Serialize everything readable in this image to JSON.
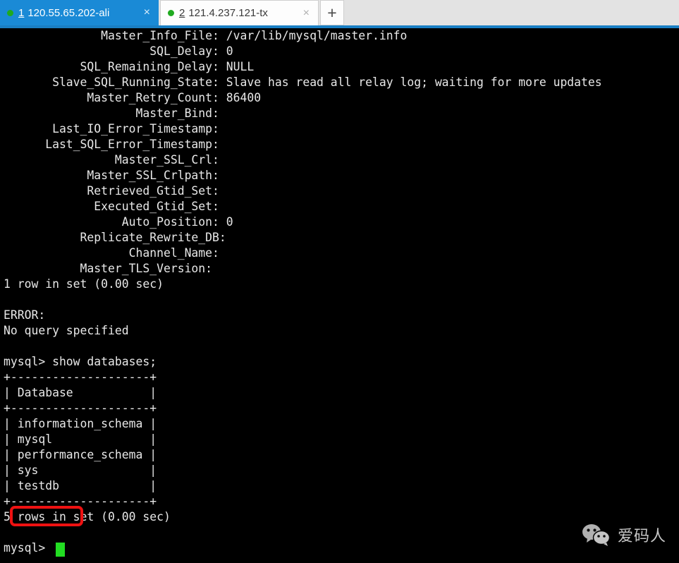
{
  "tabs": [
    {
      "index": "1",
      "title": "120.55.65.202-ali",
      "status_icon": "green-dot-icon",
      "close_icon": "×",
      "active": true
    },
    {
      "index": "2",
      "title": "121.4.237.121-tx",
      "status_icon": "green-dot-icon",
      "close_icon": "×",
      "active": false
    }
  ],
  "new_tab_button": {
    "label": "+",
    "icon": "plus-icon"
  },
  "terminal": {
    "prompt": "mysql>",
    "cursor": "block-cursor",
    "lines": [
      "              Master_Info_File: /var/lib/mysql/master.info",
      "                     SQL_Delay: 0",
      "           SQL_Remaining_Delay: NULL",
      "       Slave_SQL_Running_State: Slave has read all relay log; waiting for more updates",
      "            Master_Retry_Count: 86400",
      "                   Master_Bind: ",
      "       Last_IO_Error_Timestamp: ",
      "      Last_SQL_Error_Timestamp: ",
      "                Master_SSL_Crl: ",
      "            Master_SSL_Crlpath: ",
      "            Retrieved_Gtid_Set: ",
      "             Executed_Gtid_Set: ",
      "                 Auto_Position: 0",
      "           Replicate_Rewrite_DB: ",
      "                  Channel_Name: ",
      "           Master_TLS_Version: ",
      "1 row in set (0.00 sec)",
      "",
      "ERROR: ",
      "No query specified",
      "",
      "mysql> show databases;",
      "+--------------------+",
      "| Database           |",
      "+--------------------+",
      "| information_schema |",
      "| mysql              |",
      "| performance_schema |",
      "| sys                |",
      "| testdb             |",
      "+--------------------+",
      "5 rows in set (0.00 sec)",
      "",
      "mysql> "
    ],
    "replication_status": {
      "Master_Info_File": "/var/lib/mysql/master.info",
      "SQL_Delay": "0",
      "SQL_Remaining_Delay": "NULL",
      "Slave_SQL_Running_State": "Slave has read all relay log; waiting for more updates",
      "Master_Retry_Count": "86400",
      "Master_Bind": "",
      "Last_IO_Error_Timestamp": "",
      "Last_SQL_Error_Timestamp": "",
      "Master_SSL_Crl": "",
      "Master_SSL_Crlpath": "",
      "Retrieved_Gtid_Set": "",
      "Executed_Gtid_Set": "",
      "Auto_Position": "0",
      "Replicate_Rewrite_DB": "",
      "Channel_Name": "",
      "Master_TLS_Version": ""
    },
    "result_rows_1": "1 row in set (0.00 sec)",
    "error_label": "ERROR: ",
    "error_message": "No query specified",
    "command": "show databases;",
    "databases_table": {
      "header": "Database",
      "rows": [
        "information_schema",
        "mysql",
        "performance_schema",
        "sys",
        "testdb"
      ]
    },
    "result_rows_2": "5 rows in set (0.00 sec)",
    "highlighted_row": "testdb"
  },
  "watermark": {
    "text": "爱码人",
    "icon": "wechat-icon"
  },
  "colors": {
    "tab_active_bg": "#1a8ad6",
    "tab_bar_bg": "#e3e3e3",
    "tab_bar_underline": "#1a7fc4",
    "terminal_bg": "#000000",
    "terminal_fg": "#e8e8e8",
    "highlight_border": "#ee1111",
    "cursor": "#22dd22",
    "tab_dot": "#1faa1f"
  }
}
